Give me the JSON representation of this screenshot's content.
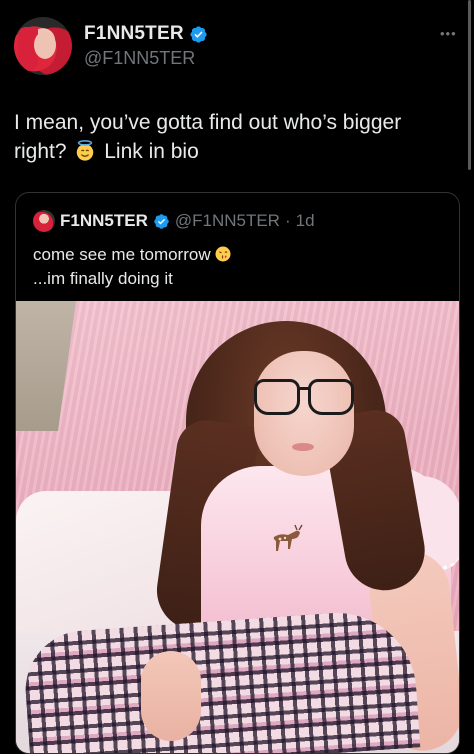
{
  "post": {
    "author": {
      "display_name": "F1NN5TER",
      "handle": "@F1NN5TER",
      "verified": true
    },
    "more_icon": "more-options-icon",
    "text_before_emoji": "I mean, you’ve gotta find out who’s bigger right?",
    "emoji": "smiling-face-with-halo",
    "text_after_emoji": "Link in bio"
  },
  "quote": {
    "author": {
      "display_name": "F1NN5TER",
      "handle": "@F1NN5TER",
      "verified": true
    },
    "separator": "·",
    "time": "1d",
    "line1": "come see me tomorrow",
    "line1_emoji": "face-blowing-a-kiss",
    "line2": "...im finally doing it",
    "media": {
      "type": "photo"
    }
  },
  "colors": {
    "background": "#000000",
    "text": "#e7e9ea",
    "muted": "#71767b",
    "border": "#2f3336",
    "verified": "#1d9bf0"
  }
}
